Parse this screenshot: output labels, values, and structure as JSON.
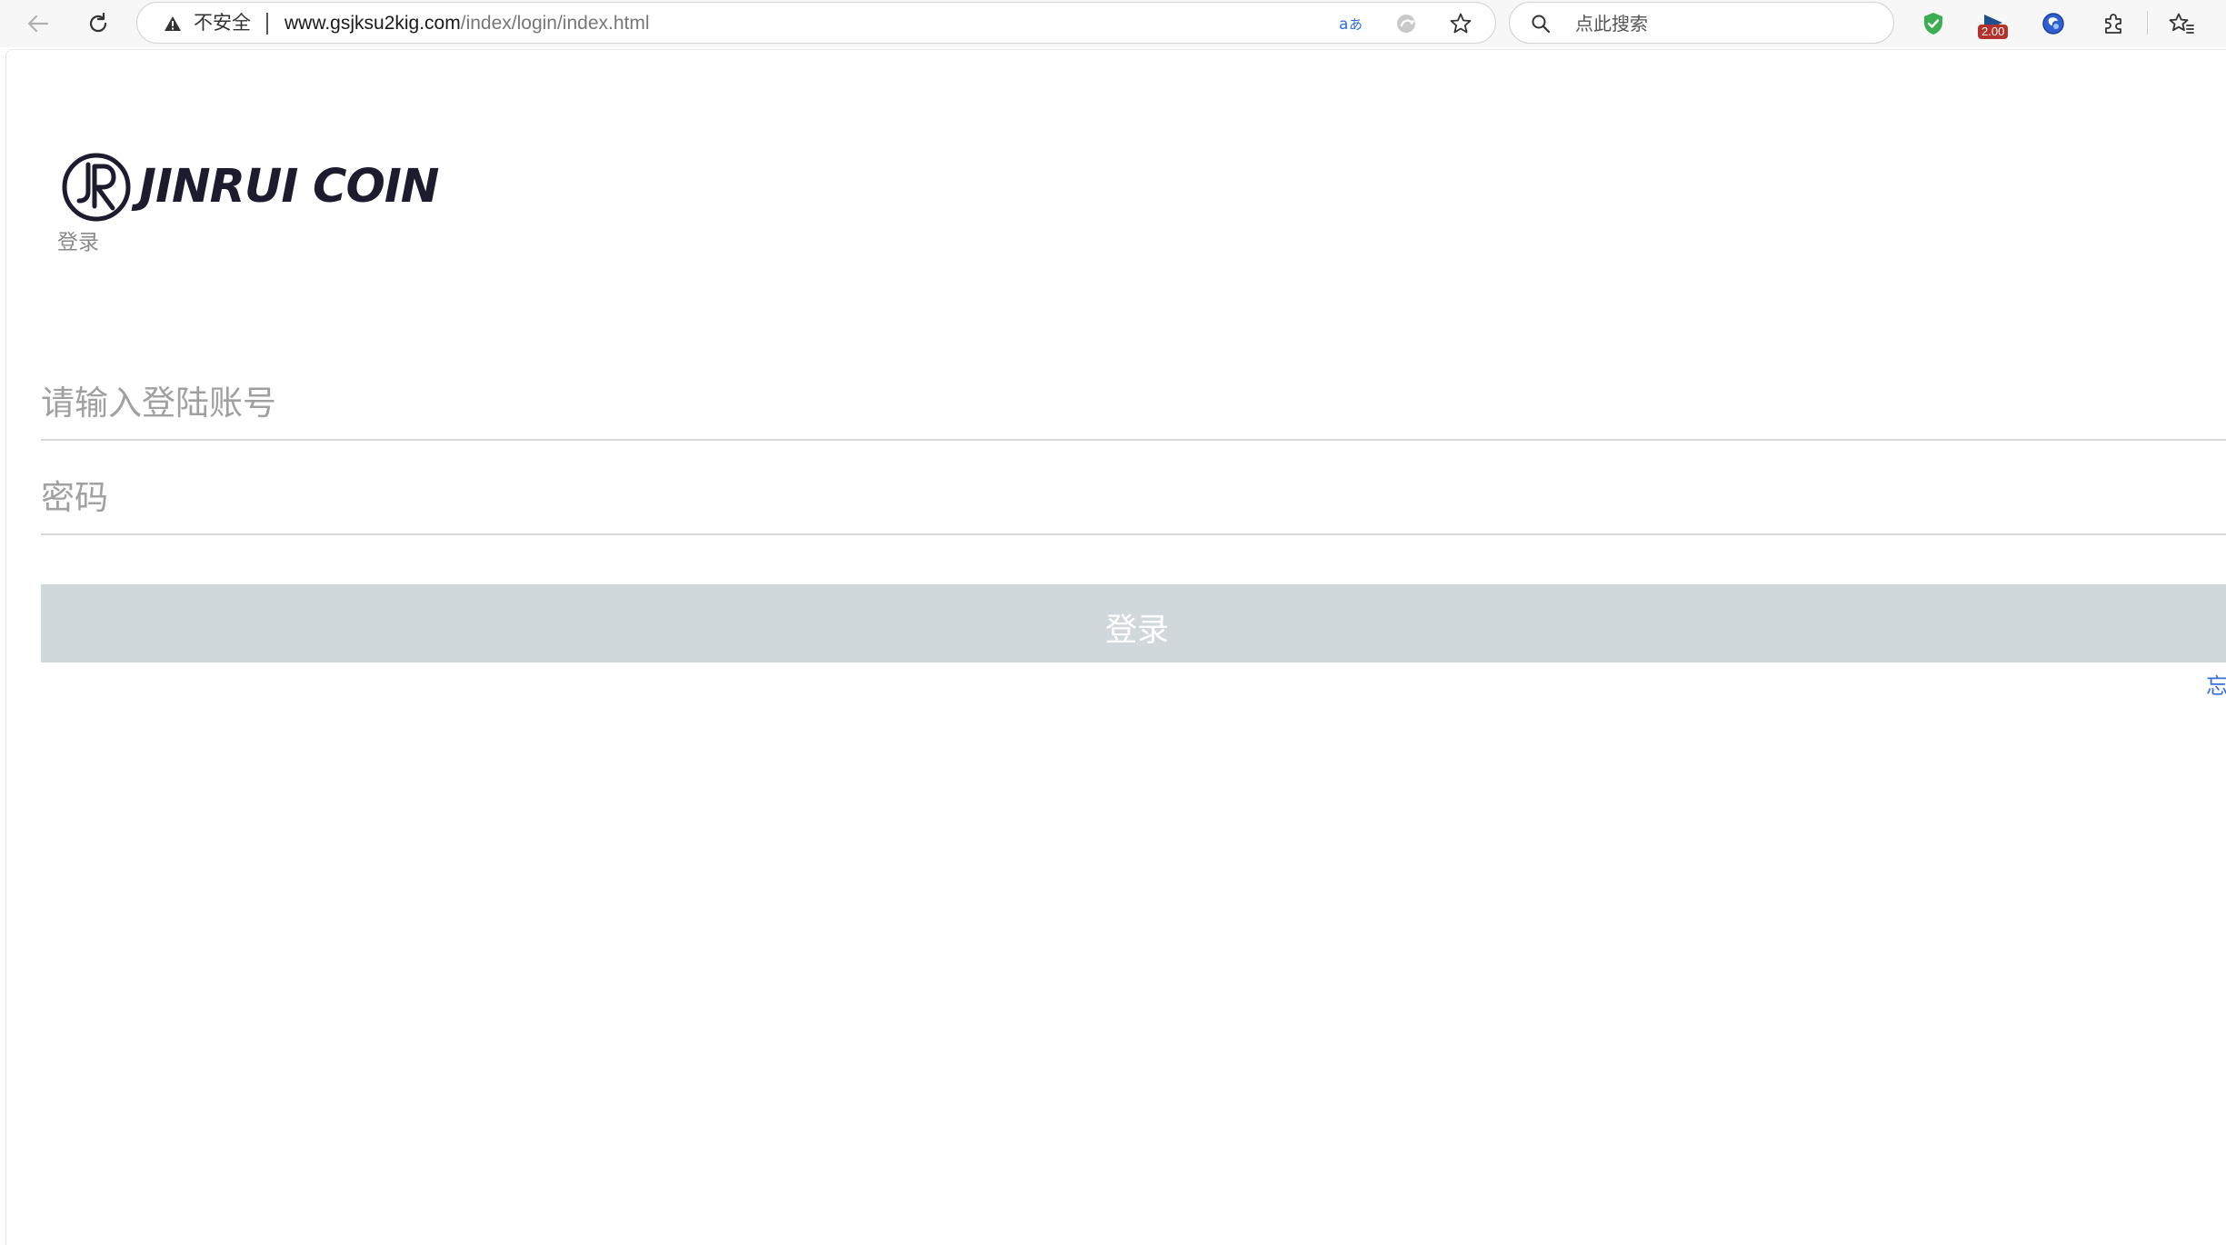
{
  "browser": {
    "security_label": "不安全",
    "url_host": "www.gsjksu2kig.com",
    "url_path": "/index/login/index.html",
    "search_placeholder": "点此搜索",
    "speed_badge": "2.00"
  },
  "page": {
    "brand_name": "JINRUI COIN",
    "subtitle": "登录",
    "account_placeholder": "请输入登陆账号",
    "password_placeholder": "密码",
    "login_button": "登录",
    "forgot_link": "忘"
  },
  "colors": {
    "button_bg": "#d0d8dc",
    "link": "#3b6fd8",
    "brand_text": "#1c1c2e"
  },
  "icons": [
    "back-arrow-icon",
    "reload-icon",
    "warning-icon",
    "translate-icon",
    "immersive-reader-icon",
    "star-icon",
    "search-icon",
    "shield-check-icon",
    "video-speed-icon",
    "globe-icon",
    "puzzle-icon",
    "favorites-icon"
  ]
}
